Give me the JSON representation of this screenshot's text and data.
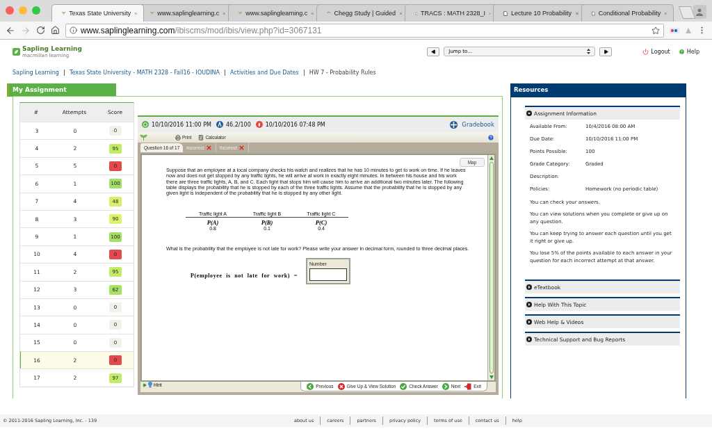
{
  "browser": {
    "tabs": [
      {
        "title": "Texas State University",
        "kind": "leaf",
        "selected": true
      },
      {
        "title": "www.saplinglearning.c",
        "kind": "leaf",
        "selected": false
      },
      {
        "title": "www.saplinglearning.c",
        "kind": "leaf",
        "selected": false
      },
      {
        "title": "Chegg Study | Guided",
        "kind": "spinner",
        "selected": false
      },
      {
        "title": "TRACS : MATH 2328_I",
        "kind": "page",
        "selected": false
      },
      {
        "title": "Lecture 10 Probability",
        "kind": "page",
        "selected": false
      },
      {
        "title": "Conditional Probability",
        "kind": "page",
        "selected": false
      }
    ],
    "url_host": "www.saplinglearning.com",
    "url_path": "/ibiscms/mod/ibis/view.php?id=3067131"
  },
  "header": {
    "logo": "Sapling Learning",
    "tagline": "macmillan learning",
    "jump": "Jump to...",
    "logout": "Logout",
    "help": "Help"
  },
  "breadcrumb": [
    "Sapling Learning",
    "Texas State University - MATH 2328 - Fall16 - IOUDINA",
    "Activities and Due Dates",
    "HW 7 - Probability Rules"
  ],
  "assignment": {
    "title": "My Assignment",
    "columns": [
      "#",
      "Attempts",
      "Score"
    ],
    "rows": [
      {
        "number": "3",
        "attempts": "0",
        "score": "0",
        "color": "#f2f2ea",
        "selected": false
      },
      {
        "number": "4",
        "attempts": "2",
        "score": "95",
        "color": "#c3ec66",
        "selected": false
      },
      {
        "number": "5",
        "attempts": "5",
        "score": "0",
        "color": "#e4474c",
        "selected": false
      },
      {
        "number": "6",
        "attempts": "1",
        "score": "100",
        "color": "#a3df66",
        "selected": false
      },
      {
        "number": "7",
        "attempts": "4",
        "score": "48",
        "color": "#d6f06a",
        "selected": false
      },
      {
        "number": "8",
        "attempts": "3",
        "score": "90",
        "color": "#dff26b",
        "selected": false
      },
      {
        "number": "9",
        "attempts": "1",
        "score": "100",
        "color": "#a3df66",
        "selected": false
      },
      {
        "number": "10",
        "attempts": "4",
        "score": "0",
        "color": "#e4474c",
        "selected": false
      },
      {
        "number": "11",
        "attempts": "2",
        "score": "95",
        "color": "#c3ec66",
        "selected": false
      },
      {
        "number": "12",
        "attempts": "3",
        "score": "62",
        "color": "#a9e066",
        "selected": false
      },
      {
        "number": "13",
        "attempts": "0",
        "score": "0",
        "color": "#f2f2ea",
        "selected": false
      },
      {
        "number": "14",
        "attempts": "0",
        "score": "0",
        "color": "#f2f2ea",
        "selected": false
      },
      {
        "number": "15",
        "attempts": "0",
        "score": "0",
        "color": "#f2f2ea",
        "selected": false
      },
      {
        "number": "16",
        "attempts": "2",
        "score": "0",
        "color": "#e4474c",
        "selected": true
      },
      {
        "number": "17",
        "attempts": "2",
        "score": "97",
        "color": "#c3ec66",
        "selected": false
      }
    ]
  },
  "question": {
    "due": "10/10/2016 11:00 PM",
    "score": "46.2/100",
    "submitted": "10/10/2016 07:48 PM",
    "gradebook": "Gradebook",
    "print": "Print",
    "calculator": "Calculator",
    "tabs": [
      {
        "label": "Question 16 of 17",
        "kind": "question",
        "selected": true
      },
      {
        "label": "Incorrect",
        "kind": "attempt",
        "selected": false
      },
      {
        "label": "Incorrect",
        "kind": "attempt",
        "selected": false
      }
    ],
    "map": "Map",
    "text": "Suppose that an employee at a local company checks his watch and realizes that he has 10 minutes to get to work on time. If he leaves now and does not get stopped by any traffic lights, he will arrive at work in exactly eight minutes. In between his house and his work there are three traffic lights, A, B, and C. Each light that stops him will cause him to arrive an additional two minutes later. The following table displays the probability that he is stopped by each of the three traffic lights. Assume that the probability that he is stopped by any given light is independent of the probability that he is stopped by any other light.",
    "table": [
      {
        "heading": "Traffic light A",
        "symbol": "P(A)",
        "value": "0.8"
      },
      {
        "heading": "Traffic light B",
        "symbol": "P(B)",
        "value": "0.1"
      },
      {
        "heading": "Traffic light C",
        "symbol": "P(C)",
        "value": "0.4"
      }
    ],
    "prompt": "What is the probability that the employee is not late for work? Please write your answer in decimal form, rounded to three decimal places.",
    "equation": "P(employee is not late for work) =",
    "answer_label": "Number",
    "hint": "Hint",
    "actions": [
      {
        "label": "Previous",
        "kind": "previous"
      },
      {
        "label": "Give Up & View Solution",
        "kind": "giveup"
      },
      {
        "label": "Check Answer",
        "kind": "check"
      },
      {
        "label": "Next",
        "kind": "next"
      },
      {
        "label": "Exit",
        "kind": "exit"
      }
    ]
  },
  "resources": {
    "title": "Resources",
    "sections": [
      {
        "title": "Assignment Information",
        "expanded": true,
        "fields": [
          {
            "label": "Available From:",
            "value": "10/4/2016 08:00 AM"
          },
          {
            "label": "Due Date:",
            "value": "10/10/2016 11:00 PM"
          },
          {
            "label": "Points Possible:",
            "value": "100"
          },
          {
            "label": "Grade Category:",
            "value": "Graded"
          },
          {
            "label": "Description:"
          },
          {
            "label": "Policies:",
            "value": "Homework (no periodic table)"
          }
        ],
        "notes": [
          "You can check your answers.",
          "You can view solutions when you complete or give up on any question.",
          "You can keep trying to answer each question until you get it right or give up.",
          "You lose 5% of the points available to each answer in your question for each incorrect attempt at that answer."
        ]
      },
      {
        "title": "eTextbook",
        "expanded": false
      },
      {
        "title": "Help With This Topic",
        "expanded": false
      },
      {
        "title": "Web Help & Videos",
        "expanded": false
      },
      {
        "title": "Technical Support and Bug Reports",
        "expanded": false
      }
    ]
  },
  "footer": {
    "copyright": "© 2011-2016 Sapling Learning, Inc. - 139",
    "links": [
      "about us",
      "careers",
      "partners",
      "privacy policy",
      "terms of use",
      "contact us",
      "help"
    ]
  }
}
